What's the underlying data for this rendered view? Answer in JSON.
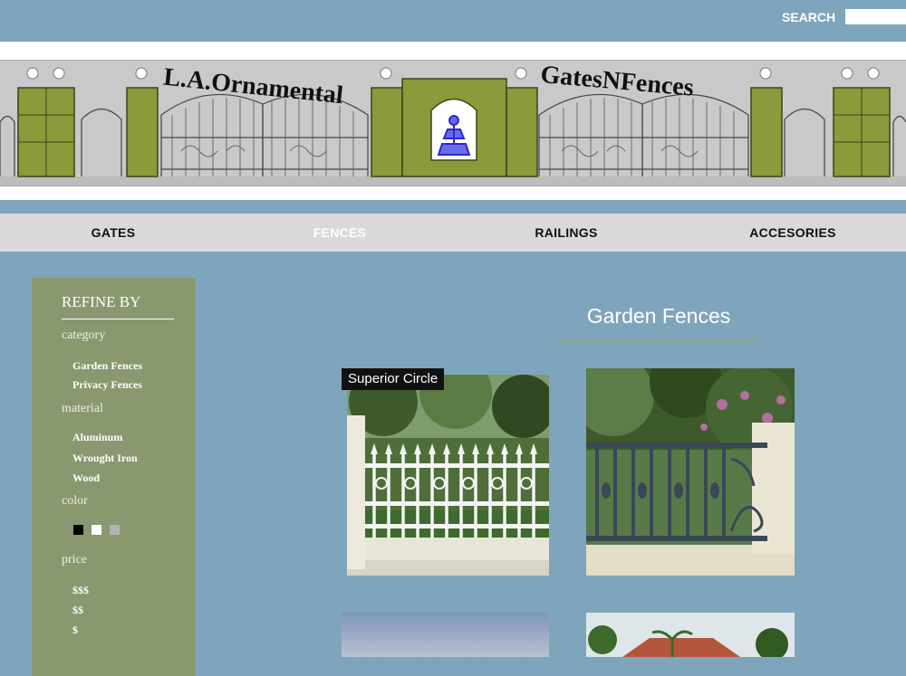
{
  "header": {
    "search_label": "SEARCH",
    "search_value": "",
    "brand_left": "L.A.Ornamental",
    "brand_right": "GatesNFences"
  },
  "nav": {
    "items": [
      {
        "label": "GATES",
        "active": false
      },
      {
        "label": "FENCES",
        "active": true
      },
      {
        "label": "RAILINGS",
        "active": false
      },
      {
        "label": "ACCESORIES",
        "active": false
      }
    ]
  },
  "sidebar": {
    "title": "REFINE BY",
    "category_label": "category",
    "categories": [
      "Garden Fences",
      "Privacy Fences"
    ],
    "material_label": "material",
    "materials": [
      "Aluminum",
      "Wrought Iron",
      "Wood"
    ],
    "color_label": "color",
    "colors": [
      "#000000",
      "#ffffff",
      "#b3b3b3"
    ],
    "price_label": "price",
    "prices": [
      "$$$",
      "$$",
      "$"
    ]
  },
  "main": {
    "title": "Garden Fences",
    "products": [
      {
        "label": "Superior Circle",
        "image": "white-aluminum-picket-fence-photo"
      },
      {
        "image": "dark-wrought-iron-scroll-fence-photo"
      },
      {
        "image": "fence-photo-sky"
      },
      {
        "image": "fence-photo-roof-palms"
      }
    ]
  },
  "theme": {
    "background": "#7fa5bc",
    "sidebar": "#8a9870",
    "nav_bar": "#d9d9d9",
    "accent_rule": "#9aa56e",
    "pillar_green": "#8b9a3a"
  }
}
